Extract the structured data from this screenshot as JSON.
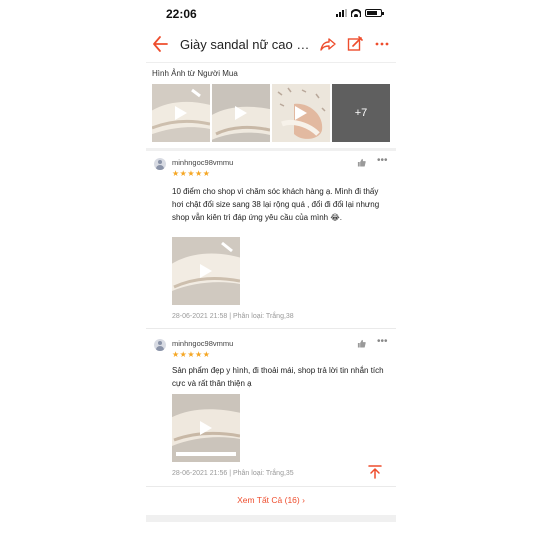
{
  "status_bar": {
    "time": "22:06"
  },
  "header": {
    "title": "Giày sandal nữ cao gót..."
  },
  "buyer_photos": {
    "label": "Hình Ảnh từ Người Mua",
    "more": "+7"
  },
  "reviews": [
    {
      "user": "minhngoc98vmmu",
      "stars": "★★★★★",
      "text": "10 điểm cho shop vì chăm sóc khách hàng ạ. Mình đi thấy hơi chật đổi size sang 38 lại rộng quá , đổi đi đổi lại nhưng shop vẫn kiên trì đáp ứng yêu cầu của mình 😂.",
      "meta": "28-06-2021 21:58 | Phân loại: Trắng,38"
    },
    {
      "user": "minhngoc98vmmu",
      "stars": "★★★★★",
      "text": "Sản phẩm đẹp y hình, đi thoải mái, shop trả lời tin nhắn tích cực và rất thân thiện ạ",
      "meta": "28-06-2021 21:56 | Phân loại: Trắng,35"
    }
  ],
  "footer": {
    "see_all": "Xem Tất Cả (16) ›"
  },
  "colors": {
    "accent": "#ee4d2d",
    "star": "#f5a623"
  }
}
